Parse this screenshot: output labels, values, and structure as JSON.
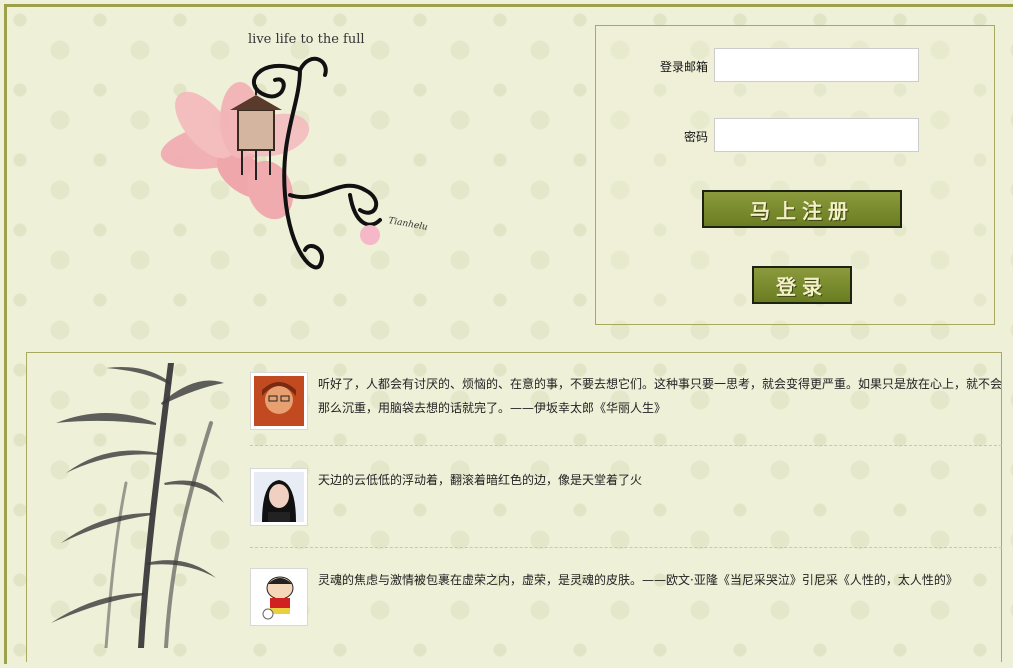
{
  "hero": {
    "tagline": "live life to the full",
    "signature": "Tianhelu"
  },
  "login": {
    "email_label": "登录邮箱",
    "email_value": "",
    "password_label": "密码",
    "password_value": "",
    "register_button": "马上注册",
    "login_button": "登录"
  },
  "feed": {
    "items": [
      {
        "quote": "听好了，人都会有讨厌的、烦恼的、在意的事，不要去想它们。这种事只要一思考，就会变得更严重。如果只是放在心上，就不会那么沉重，用脑袋去想的话就完了。——伊坂幸太郎《华丽人生》",
        "avatar": "avatar-user-1"
      },
      {
        "quote": "天边的云低低的浮动着，翻滚着暗红色的边，像是天堂着了火",
        "avatar": "avatar-user-2"
      },
      {
        "quote": "灵魂的焦虑与激情被包裹在虚荣之内，虚荣，是灵魂的皮肤。——欧文·亚隆《当尼采哭泣》引尼采《人性的，太人性的》",
        "avatar": "avatar-user-3"
      }
    ]
  },
  "colors": {
    "accent": "#6b7d22",
    "border": "#9ca04a",
    "background": "#eef0d8"
  }
}
